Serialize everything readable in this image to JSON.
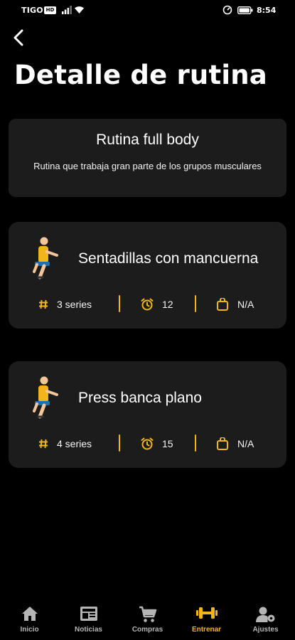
{
  "colors": {
    "accent": "#f2b61a",
    "card": "#1c1c1c",
    "background": "#000000"
  },
  "status_bar": {
    "carrier": "TIGO",
    "badge": "HD",
    "time": "8:54"
  },
  "header": {
    "back_icon": "chevron-left-icon",
    "title": "Detalle de rutina"
  },
  "routine": {
    "name": "Rutina full body",
    "description": "Rutina que trabaja gran parte de los grupos musculares"
  },
  "exercises": [
    {
      "name": "Sentadillas con mancuerna",
      "series": "3 series",
      "reps": "12",
      "weight": "N/A",
      "icon": "squat-person-icon"
    },
    {
      "name": "Press banca plano",
      "series": "4 series",
      "reps": "15",
      "weight": "N/A",
      "icon": "squat-person-icon"
    }
  ],
  "nav": {
    "items": [
      {
        "label": "Inicio",
        "icon": "home-icon",
        "active": false
      },
      {
        "label": "Noticias",
        "icon": "newspaper-icon",
        "active": false
      },
      {
        "label": "Compras",
        "icon": "cart-icon",
        "active": false
      },
      {
        "label": "Entrenar",
        "icon": "dumbbell-icon",
        "active": true
      },
      {
        "label": "Ajustes",
        "icon": "user-settings-icon",
        "active": false
      }
    ]
  }
}
